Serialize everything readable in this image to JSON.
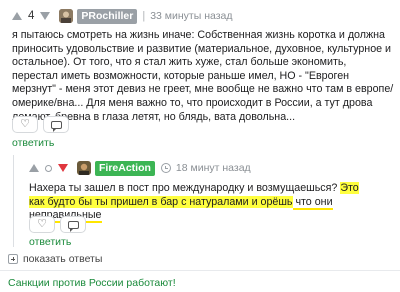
{
  "comment1": {
    "score": "4",
    "username": "PRochiller",
    "username_color": "#9aa0a6",
    "time": "33 минуты назад",
    "text": "я пытаюсь смотреть на жизнь иначе: Собственная жизнь коротка и должна приносить удовольствие и развитие (материальное, духовное, культурное и остальное). От того, что я стал жить хуже, стал больше экономить, перестал иметь возможности, которые раньше имел, НО - \"Евроген мерзнут\" - меня этот девиз не греет, мне вообще не важно что там в европе/омерике/вна... Для меня важно то, что происходит в России, а тут дрова ломают, бревна в глаза летят, но блядь, вата довольна...",
    "reply_label": "ответить"
  },
  "comment2": {
    "username": "FireAction",
    "username_color": "#3cb554",
    "time": "18 минут назад",
    "text_plain": "Нахера ты зашел в пост про международку и возмущаешься? ",
    "text_highlight_1": "Это как будто бы ты пришел в бар с натуралами и орёшь",
    "text_highlight_2": " что они неправильные",
    "reply_label": "ответить"
  },
  "show_replies_label": "показать ответы",
  "footer_text": "Санкции против России работают!",
  "icons": {
    "upvote": "arrow-up-icon",
    "downvote": "arrow-down-icon",
    "like": "heart-icon",
    "comment": "comment-icon",
    "time": "clock-icon",
    "expand": "plus-icon"
  },
  "colors": {
    "accent_green": "#1a8a3b",
    "downvote_red": "#e0363e",
    "highlight_yellow": "#ffff3f"
  }
}
